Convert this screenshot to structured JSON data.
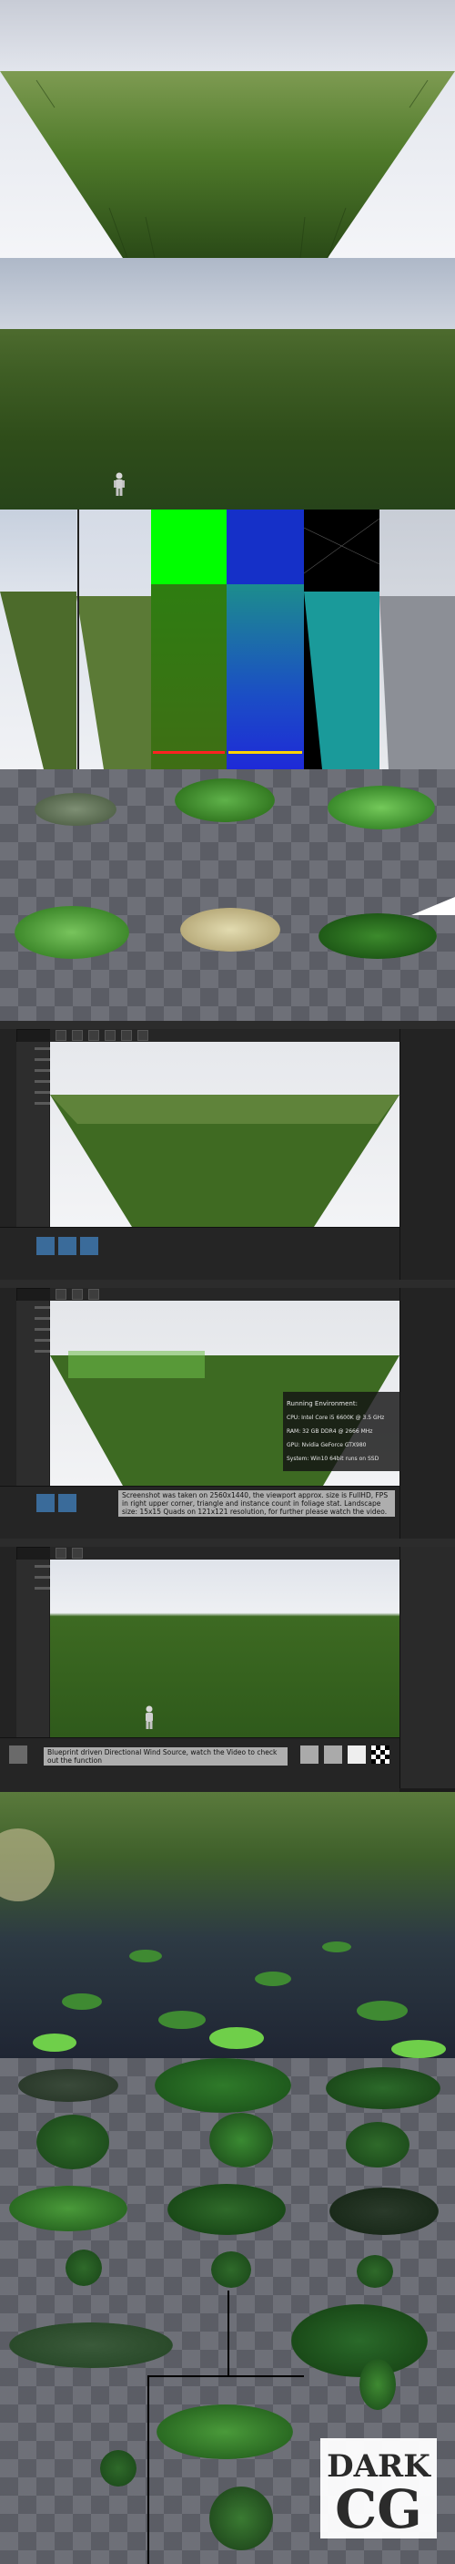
{
  "panels": {
    "running_env": {
      "heading": "Running Environment:",
      "lines": [
        "CPU: Intel Core i5 6600K @ 3.5 GHz",
        "RAM: 32 GB DDR4 @ 2666 MHz",
        "GPU: Nvidia GeForce GTX980",
        "System: Win10 64bit runs on SSD"
      ]
    },
    "screenshot_note": "Screenshot was taken on 2560x1440, the viewport approx. size is FullHD, FPS in right upper corner, triangle and instance count in foliage stat. Landscape size: 15x15 Quads on 121x121 resolution, for further please watch the video.",
    "wind_note": "Blueprint driven Directional Wind Source, watch the Video to check out the function"
  },
  "watermark": {
    "line1": "DARK",
    "line2": "CG"
  },
  "colors": {
    "grass_dark": "#2f4d1a",
    "grass_light": "#6f8f3e",
    "debug_green": "#00ff00",
    "debug_blue": "#1e2ad8",
    "debug_cyan": "#1a9a9a"
  }
}
